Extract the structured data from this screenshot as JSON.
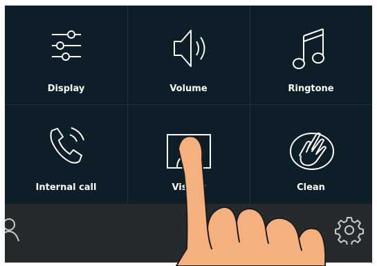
{
  "tiles": [
    {
      "label": "Display",
      "icon": "sliders-icon"
    },
    {
      "label": "Volume",
      "icon": "speaker-icon"
    },
    {
      "label": "Ringtone",
      "icon": "music-note-icon"
    },
    {
      "label": "Internal call",
      "icon": "phone-ringing-icon"
    },
    {
      "label": "Visitor",
      "icon": "visitor-photo-icon"
    },
    {
      "label": "Clean",
      "icon": "cleaning-hand-icon"
    }
  ],
  "bottom_bar": {
    "left_icon": "contacts-icon",
    "right_icon": "gear-icon"
  },
  "overlay": {
    "icon": "pointing-finger"
  },
  "colors": {
    "screen_bg": "#0e1e28",
    "bar_bg": "#262a2d",
    "text": "#ffffff",
    "skin": "#f6b07e",
    "skin_outline": "#1c1c1c"
  }
}
